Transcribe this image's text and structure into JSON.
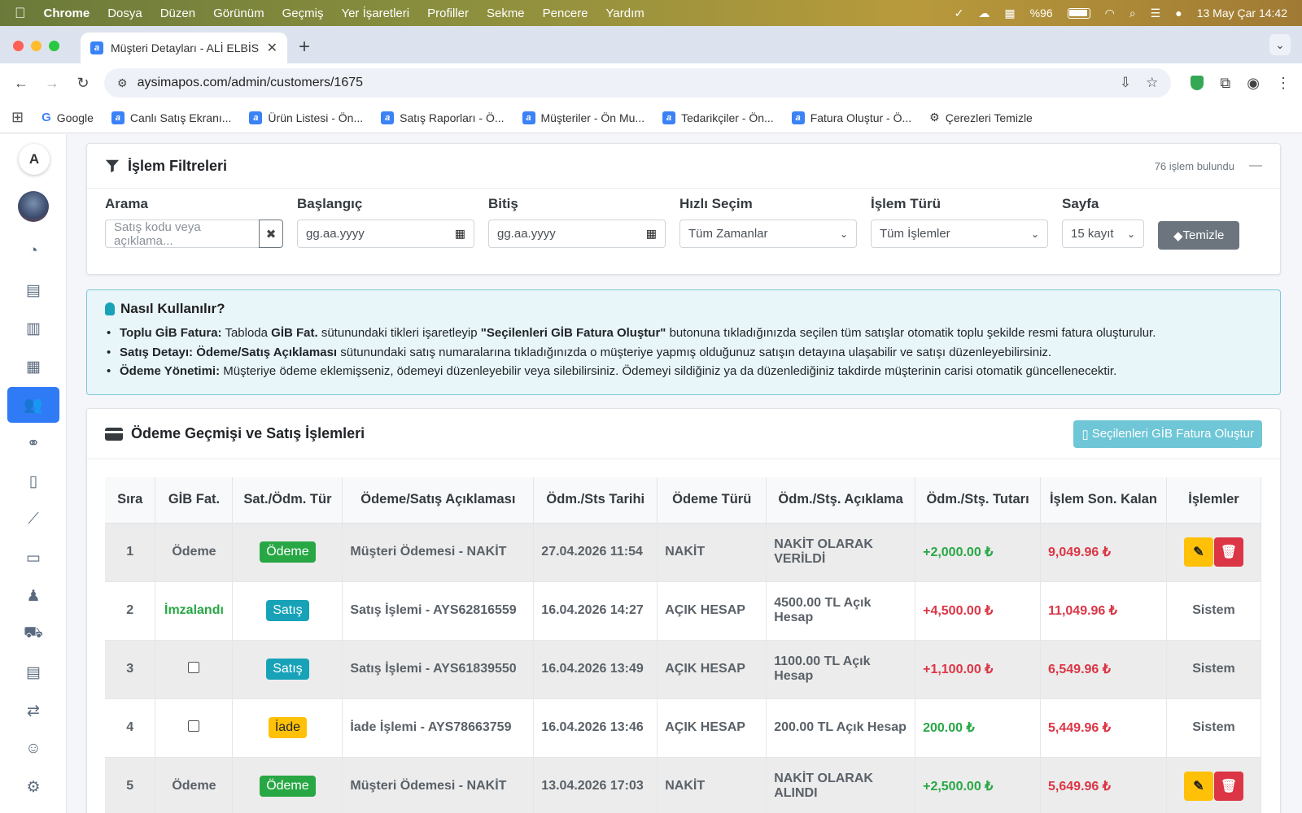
{
  "menubar": {
    "app": "Chrome",
    "items": [
      "Dosya",
      "Düzen",
      "Görünüm",
      "Geçmiş",
      "Yer İşaretleri",
      "Profiller",
      "Sekme",
      "Pencere",
      "Yardım"
    ],
    "battery": "%96",
    "datetime": "13 May Çar  14:42"
  },
  "browser": {
    "tab_title": "Müşteri Detayları - ALİ ELBİS",
    "url": "aysimapos.com/admin/customers/1675",
    "bookmarks": [
      "Google",
      "Canlı Satış Ekranı...",
      "Ürün Listesi - Ön...",
      "Satış Raporları - Ö...",
      "Müşteriler - Ön Mu...",
      "Tedarikçiler - Ön...",
      "Fatura Oluştur - Ö...",
      "Çerezleri Temizle"
    ]
  },
  "sidebar": {
    "logo": "A",
    "items": [
      "dashboard",
      "cash-register",
      "clipboard",
      "boxes",
      "users",
      "handshake",
      "file",
      "chart",
      "credit-card",
      "user-tie",
      "truck",
      "invoice",
      "exchange",
      "user",
      "settings"
    ],
    "active": "users"
  },
  "filters": {
    "title": "İşlem Filtreleri",
    "count": "76 işlem bulundu",
    "search_label": "Arama",
    "search_placeholder": "Satış kodu veya açıklama...",
    "start_label": "Başlangıç",
    "start_value": "gg.aa.yyyy",
    "end_label": "Bitiş",
    "end_value": "gg.aa.yyyy",
    "quick_label": "Hızlı Seçim",
    "quick_value": "Tüm Zamanlar",
    "type_label": "İşlem Türü",
    "type_value": "Tüm İşlemler",
    "page_label": "Sayfa",
    "page_value": "15 kayıt",
    "clear_button": "Temizle"
  },
  "info": {
    "title": "Nasıl Kullanılır?",
    "items": [
      {
        "head": "Toplu GİB Fatura:",
        "parts": [
          " Tabloda ",
          "GİB Fat.",
          " sütunundaki tikleri işaretleyip ",
          "\"Seçilenleri GİB Fatura Oluştur\"",
          " butonuna tıkladığınızda seçilen tüm satışlar otomatik toplu şekilde resmi fatura oluşturulur."
        ]
      },
      {
        "head": "Satış Detayı:",
        "parts": [
          " ",
          "Ödeme/Satış Açıklaması",
          " sütunundaki satış numaralarına tıkladığınızda o müşteriye yapmış olduğunuz satışın detayına ulaşabilir ve satışı düzenleyebilirsiniz."
        ]
      },
      {
        "head": "Ödeme Yönetimi:",
        "parts": [
          " Müşteriye ödeme eklemişseniz, ödemeyi düzenleyebilir veya silebilirsiniz. Ödemeyi sildiğiniz ya da düzenlediğiniz takdirde müşterinin carisi otomatik güncellenecektir."
        ]
      }
    ]
  },
  "history": {
    "title": "Ödeme Geçmişi ve Satış İşlemleri",
    "gib_button": "Seçilenleri GİB Fatura Oluştur",
    "columns": [
      "Sıra",
      "GİB Fat.",
      "Sat./Ödm. Tür",
      "Ödeme/Satış Açıklaması",
      "Ödm./Sts Tarihi",
      "Ödeme Türü",
      "Ödm./Stş. Açıklama",
      "Ödm./Stş. Tutarı",
      "İşlem Son. Kalan",
      "İşlemler"
    ],
    "rows": [
      {
        "no": "1",
        "gib": "Ödeme",
        "gib_kind": "text",
        "type": "Ödeme",
        "type_color": "green",
        "desc": "Müşteri Ödemesi - NAKİT",
        "date": "27.04.2026 11:54",
        "pay": "NAKİT",
        "note": "NAKİT OLARAK VERİLDİ",
        "amount": "+2,000.00 ₺",
        "amount_color": "green",
        "remain": "9,049.96 ₺",
        "actions": "buttons"
      },
      {
        "no": "2",
        "gib": "İmzalandı",
        "gib_kind": "signed",
        "type": "Satış",
        "type_color": "teal",
        "desc": "Satış İşlemi - AYS62816559",
        "date": "16.04.2026 14:27",
        "pay": "AÇIK HESAP",
        "note": "4500.00 TL Açık Hesap",
        "amount": "+4,500.00 ₺",
        "amount_color": "red",
        "remain": "11,049.96 ₺",
        "actions": "Sistem"
      },
      {
        "no": "3",
        "gib": "",
        "gib_kind": "checkbox",
        "type": "Satış",
        "type_color": "teal",
        "desc": "Satış İşlemi - AYS61839550",
        "date": "16.04.2026 13:49",
        "pay": "AÇIK HESAP",
        "note": "1100.00 TL Açık Hesap",
        "amount": "+1,100.00 ₺",
        "amount_color": "red",
        "remain": "6,549.96 ₺",
        "actions": "Sistem"
      },
      {
        "no": "4",
        "gib": "",
        "gib_kind": "checkbox",
        "type": "İade",
        "type_color": "yellow",
        "desc": "İade İşlemi - AYS78663759",
        "date": "16.04.2026 13:46",
        "pay": "AÇIK HESAP",
        "note": "200.00 TL Açık Hesap",
        "amount": "200.00 ₺",
        "amount_color": "green",
        "remain": "5,449.96 ₺",
        "actions": "Sistem"
      },
      {
        "no": "5",
        "gib": "Ödeme",
        "gib_kind": "text",
        "type": "Ödeme",
        "type_color": "green",
        "desc": "Müşteri Ödemesi - NAKİT",
        "date": "13.04.2026 17:03",
        "pay": "NAKİT",
        "note": "NAKİT OLARAK ALINDI",
        "amount": "+2,500.00 ₺",
        "amount_color": "green",
        "remain": "5,649.96 ₺",
        "actions": "buttons"
      }
    ]
  }
}
